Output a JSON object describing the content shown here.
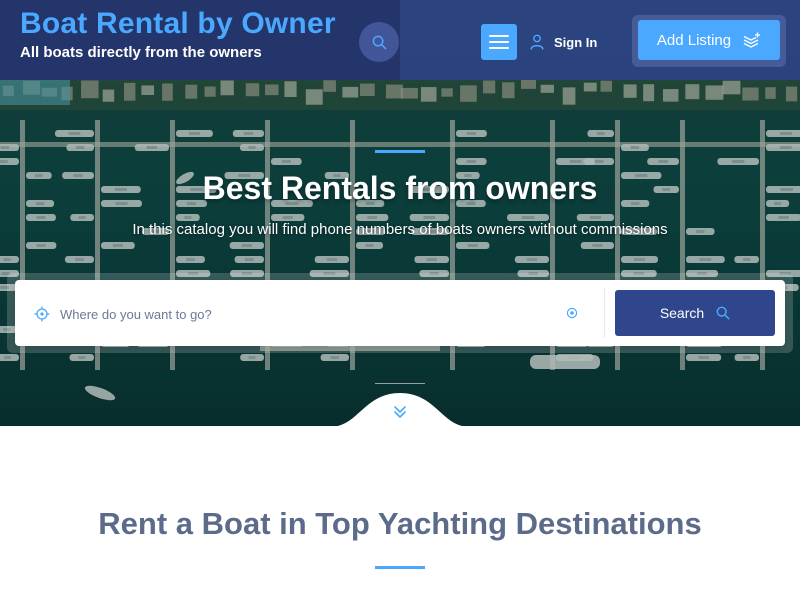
{
  "header": {
    "site_title": "Boat Rental by Owner",
    "tagline": "All boats directly from the owners",
    "sign_in_label": "Sign In",
    "add_listing_label": "Add Listing"
  },
  "hero": {
    "title": "Best Rentals from owners",
    "subtitle": "In this catalog you will find phone numbers of boats owners without commissions"
  },
  "search": {
    "placeholder": "Where do you want to go?",
    "button_label": "Search"
  },
  "section": {
    "title": "Rent a Boat in Top Yachting Destinations"
  },
  "colors": {
    "accent": "#4aa8ff",
    "primary": "#2f468c",
    "header_bg": "#24346e",
    "section_title": "#5d6b8a"
  },
  "icons": {
    "header_search": "search-icon",
    "menu": "hamburger-icon",
    "sign_in": "user-icon",
    "add_listing": "layers-plus-icon",
    "where": "crosshair-icon",
    "locate": "target-dot-icon",
    "search_button": "search-icon",
    "scroll": "chevron-double-down-icon"
  }
}
